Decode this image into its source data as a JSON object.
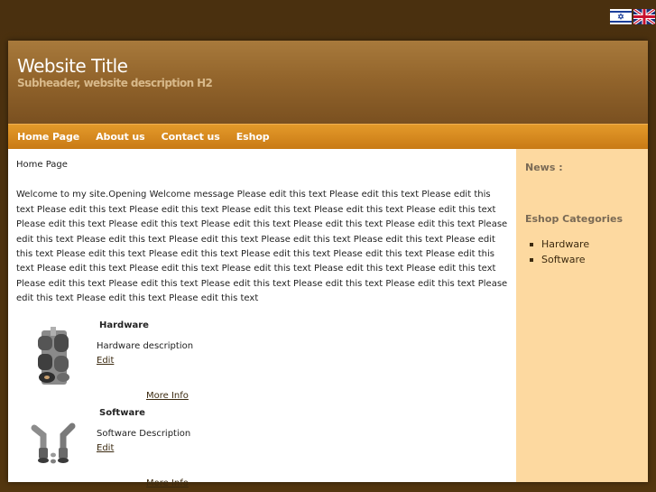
{
  "header": {
    "title": "Website Title",
    "subtitle": "Subheader, website description H2"
  },
  "nav": {
    "items": [
      "Home Page",
      "About us",
      "Contact us",
      "Eshop"
    ]
  },
  "main": {
    "breadcrumb": "Home Page",
    "welcome": "Welcome to my site.Opening Welcome message Please edit this text Please edit this text Please edit this text Please edit this text Please edit this text Please edit this text Please edit this text Please edit this text Please edit this text Please edit this text Please edit this text Please edit this text Please edit this text Please edit this text Please edit this text Please edit this text Please edit this text Please edit this text Please edit this text Please edit this text Please edit this text Please edit this text Please edit this text Please edit this text Please edit this text Please edit this text Please edit this text Please edit this text Please edit this text Please edit this text Please edit this text Please edit this text Please edit this text Please edit this text Please edit this text Please edit this text Please edit this text",
    "products": [
      {
        "name": "Hardware",
        "description": "Hardware description",
        "edit": "Edit",
        "more": "More Info",
        "icon": "gear-shaft-icon"
      },
      {
        "name": "Software",
        "description": "Software Description",
        "edit": "Edit",
        "more": "More Info",
        "icon": "pipe-fittings-icon"
      }
    ]
  },
  "sidebar": {
    "news_title": "News :",
    "categories_title": "Eshop Categories",
    "categories": [
      "Hardware",
      "Software"
    ]
  },
  "colors": {
    "background": "#4f3310",
    "nav": "#d4851c",
    "sidebar": "#fdd9a0"
  }
}
